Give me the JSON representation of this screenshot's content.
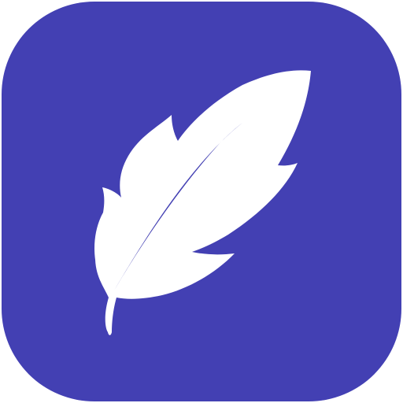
{
  "icon": {
    "name": "feather-icon",
    "background_color": "#4340b3",
    "glyph_color": "#ffffff"
  }
}
